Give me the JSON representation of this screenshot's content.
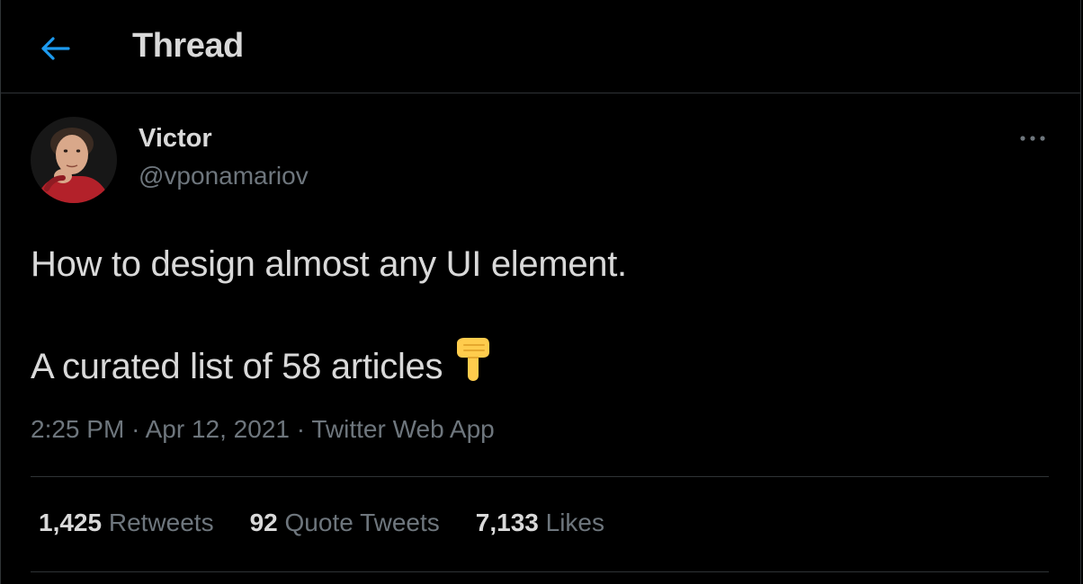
{
  "header": {
    "back_icon": "arrow-left-icon",
    "title": "Thread"
  },
  "colors": {
    "background": "#000000",
    "accent": "#1d9bf0",
    "text_primary": "#d9d9d9",
    "text_secondary": "#6e767d",
    "divider": "#2f3336"
  },
  "tweet": {
    "author": {
      "name": "Victor",
      "handle": "@vponamariov",
      "avatar_icon": "user-avatar"
    },
    "more_icon": "more-horizontal-icon",
    "text_lines": [
      "How to design almost any UI element.",
      "A curated list of 58 articles"
    ],
    "emoji": "backhand-index-pointing-down",
    "time": "2:25 PM",
    "separator": "·",
    "date": "Apr 12, 2021",
    "source": "Twitter Web App"
  },
  "stats": [
    {
      "value": "1,425",
      "label": "Retweets"
    },
    {
      "value": "92",
      "label": "Quote Tweets"
    },
    {
      "value": "7,133",
      "label": "Likes"
    }
  ]
}
